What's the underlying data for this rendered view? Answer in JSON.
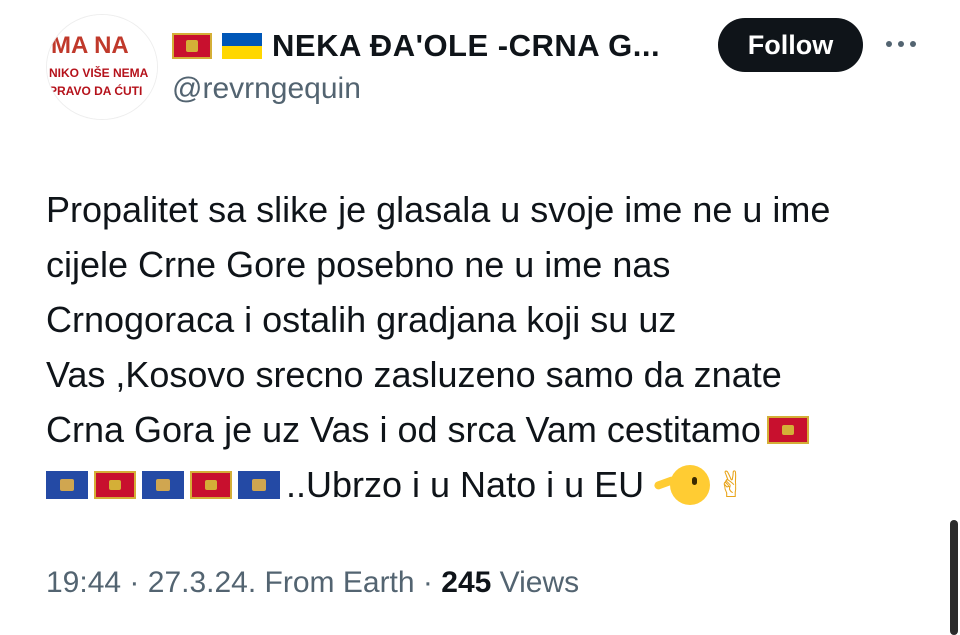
{
  "header": {
    "avatar_text_top": "MA NA",
    "avatar_text_mid": "NIKO VIŠE NEMA",
    "avatar_text_bot": "PRAVO DA ĆUTI",
    "display_name": "NEKA ĐA'OLE -CRNA G...",
    "handle": "@revrngequin",
    "follow_label": "Follow"
  },
  "tweet": {
    "line1": "Propalitet sa slike je glasala u svoje ime ne u ime",
    "line2": "cijele Crne Gore posebno ne u ime nas",
    "line3": "Crnogoraca i ostalih gradjana koji su uz",
    "line4": "Vas  ,Kosovo srecno zasluzeno samo da znate",
    "line5": "Crna Gora je uz Vas i od srca Vam cestitamo",
    "line6": "..Ubrzo i u Nato i u EU",
    "peace_glyph": "✌"
  },
  "meta": {
    "time": "19:44",
    "date": "27.3.24.",
    "source": "From Earth",
    "views_count": "245",
    "views_label": "Views",
    "separator": "·"
  },
  "colors": {
    "follow_bg": "#0f1419",
    "secondary_text": "#536471",
    "montenegro_red": "#c8102e",
    "kosovo_blue": "#244aa5"
  }
}
